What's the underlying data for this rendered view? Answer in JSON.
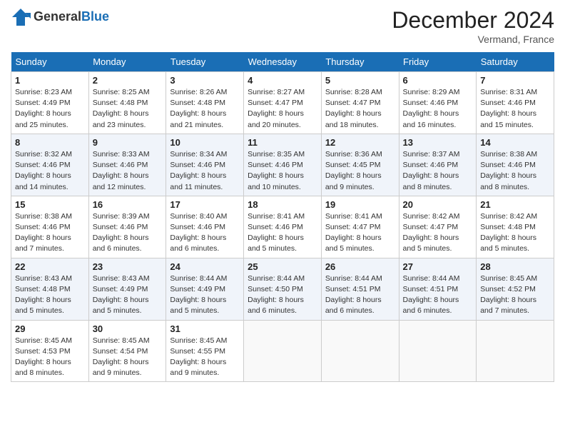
{
  "header": {
    "logo_general": "General",
    "logo_blue": "Blue",
    "month": "December 2024",
    "location": "Vermand, France"
  },
  "weekdays": [
    "Sunday",
    "Monday",
    "Tuesday",
    "Wednesday",
    "Thursday",
    "Friday",
    "Saturday"
  ],
  "weeks": [
    [
      {
        "day": "1",
        "info": "Sunrise: 8:23 AM\nSunset: 4:49 PM\nDaylight: 8 hours\nand 25 minutes."
      },
      {
        "day": "2",
        "info": "Sunrise: 8:25 AM\nSunset: 4:48 PM\nDaylight: 8 hours\nand 23 minutes."
      },
      {
        "day": "3",
        "info": "Sunrise: 8:26 AM\nSunset: 4:48 PM\nDaylight: 8 hours\nand 21 minutes."
      },
      {
        "day": "4",
        "info": "Sunrise: 8:27 AM\nSunset: 4:47 PM\nDaylight: 8 hours\nand 20 minutes."
      },
      {
        "day": "5",
        "info": "Sunrise: 8:28 AM\nSunset: 4:47 PM\nDaylight: 8 hours\nand 18 minutes."
      },
      {
        "day": "6",
        "info": "Sunrise: 8:29 AM\nSunset: 4:46 PM\nDaylight: 8 hours\nand 16 minutes."
      },
      {
        "day": "7",
        "info": "Sunrise: 8:31 AM\nSunset: 4:46 PM\nDaylight: 8 hours\nand 15 minutes."
      }
    ],
    [
      {
        "day": "8",
        "info": "Sunrise: 8:32 AM\nSunset: 4:46 PM\nDaylight: 8 hours\nand 14 minutes."
      },
      {
        "day": "9",
        "info": "Sunrise: 8:33 AM\nSunset: 4:46 PM\nDaylight: 8 hours\nand 12 minutes."
      },
      {
        "day": "10",
        "info": "Sunrise: 8:34 AM\nSunset: 4:46 PM\nDaylight: 8 hours\nand 11 minutes."
      },
      {
        "day": "11",
        "info": "Sunrise: 8:35 AM\nSunset: 4:46 PM\nDaylight: 8 hours\nand 10 minutes."
      },
      {
        "day": "12",
        "info": "Sunrise: 8:36 AM\nSunset: 4:45 PM\nDaylight: 8 hours\nand 9 minutes."
      },
      {
        "day": "13",
        "info": "Sunrise: 8:37 AM\nSunset: 4:46 PM\nDaylight: 8 hours\nand 8 minutes."
      },
      {
        "day": "14",
        "info": "Sunrise: 8:38 AM\nSunset: 4:46 PM\nDaylight: 8 hours\nand 8 minutes."
      }
    ],
    [
      {
        "day": "15",
        "info": "Sunrise: 8:38 AM\nSunset: 4:46 PM\nDaylight: 8 hours\nand 7 minutes."
      },
      {
        "day": "16",
        "info": "Sunrise: 8:39 AM\nSunset: 4:46 PM\nDaylight: 8 hours\nand 6 minutes."
      },
      {
        "day": "17",
        "info": "Sunrise: 8:40 AM\nSunset: 4:46 PM\nDaylight: 8 hours\nand 6 minutes."
      },
      {
        "day": "18",
        "info": "Sunrise: 8:41 AM\nSunset: 4:46 PM\nDaylight: 8 hours\nand 5 minutes."
      },
      {
        "day": "19",
        "info": "Sunrise: 8:41 AM\nSunset: 4:47 PM\nDaylight: 8 hours\nand 5 minutes."
      },
      {
        "day": "20",
        "info": "Sunrise: 8:42 AM\nSunset: 4:47 PM\nDaylight: 8 hours\nand 5 minutes."
      },
      {
        "day": "21",
        "info": "Sunrise: 8:42 AM\nSunset: 4:48 PM\nDaylight: 8 hours\nand 5 minutes."
      }
    ],
    [
      {
        "day": "22",
        "info": "Sunrise: 8:43 AM\nSunset: 4:48 PM\nDaylight: 8 hours\nand 5 minutes."
      },
      {
        "day": "23",
        "info": "Sunrise: 8:43 AM\nSunset: 4:49 PM\nDaylight: 8 hours\nand 5 minutes."
      },
      {
        "day": "24",
        "info": "Sunrise: 8:44 AM\nSunset: 4:49 PM\nDaylight: 8 hours\nand 5 minutes."
      },
      {
        "day": "25",
        "info": "Sunrise: 8:44 AM\nSunset: 4:50 PM\nDaylight: 8 hours\nand 6 minutes."
      },
      {
        "day": "26",
        "info": "Sunrise: 8:44 AM\nSunset: 4:51 PM\nDaylight: 8 hours\nand 6 minutes."
      },
      {
        "day": "27",
        "info": "Sunrise: 8:44 AM\nSunset: 4:51 PM\nDaylight: 8 hours\nand 6 minutes."
      },
      {
        "day": "28",
        "info": "Sunrise: 8:45 AM\nSunset: 4:52 PM\nDaylight: 8 hours\nand 7 minutes."
      }
    ],
    [
      {
        "day": "29",
        "info": "Sunrise: 8:45 AM\nSunset: 4:53 PM\nDaylight: 8 hours\nand 8 minutes."
      },
      {
        "day": "30",
        "info": "Sunrise: 8:45 AM\nSunset: 4:54 PM\nDaylight: 8 hours\nand 9 minutes."
      },
      {
        "day": "31",
        "info": "Sunrise: 8:45 AM\nSunset: 4:55 PM\nDaylight: 8 hours\nand 9 minutes."
      },
      null,
      null,
      null,
      null
    ]
  ]
}
